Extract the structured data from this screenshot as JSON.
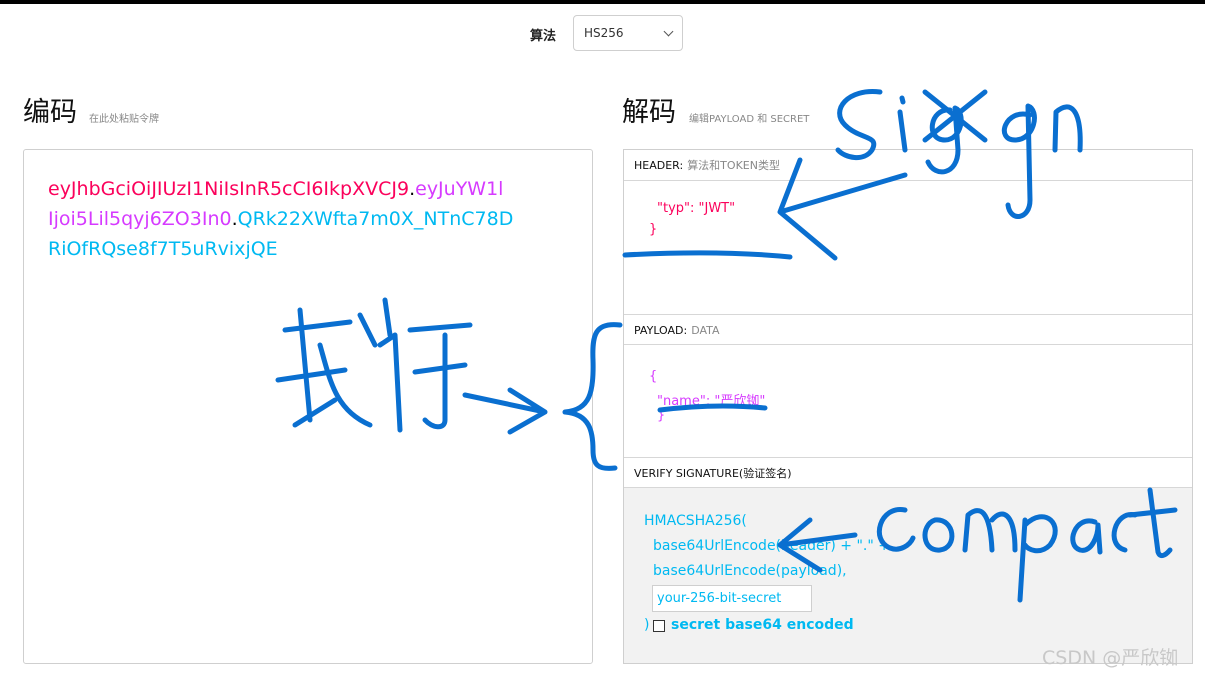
{
  "header": {
    "algorithm_label": "算法",
    "algorithm_value": "HS256"
  },
  "encoded": {
    "title": "编码",
    "subtitle": "在此处粘贴令牌",
    "lines": [
      [
        {
          "t": "eyJhbGciOiJIUzI1NiIsInR5cCI6IkpXVCJ9",
          "c": "red"
        },
        {
          "t": ".",
          "c": "dot"
        },
        {
          "t": "eyJuYW1l",
          "c": "purple"
        }
      ],
      [
        {
          "t": "Ijoi5Lil5qyj6ZO3In0",
          "c": "purple"
        },
        {
          "t": ".",
          "c": "dot"
        },
        {
          "t": "QRk22XWfta7m0X_NTnC78D",
          "c": "cyan"
        }
      ],
      [
        {
          "t": "RiOfRQse8f7T5uRvixjQE",
          "c": "cyan"
        }
      ]
    ]
  },
  "decoded": {
    "title": "解码",
    "subtitle": "编辑PAYLOAD 和 SECRET",
    "header_panel": {
      "label": "HEADER:",
      "sub": "算法和TOKEN类型",
      "line1": "\"typ\": \"JWT\"",
      "line2": "}"
    },
    "payload_panel": {
      "label": "PAYLOAD:",
      "sub": "DATA",
      "line1": "{",
      "line2": "\"name\": \"严欣铷\"",
      "line3": "}"
    },
    "verify_panel": {
      "label": "VERIFY SIGNATURE(验证签名)",
      "line1": "HMACSHA256(",
      "line2": "base64UrlEncode(header) + \".\" +",
      "line3": "base64UrlEncode(payload),",
      "secret_value": "your-256-bit-secret",
      "close": ")",
      "checkbox_label": "secret base64 encoded"
    }
  },
  "watermark": "CSDN @严欣铷",
  "colors": {
    "header": "#fb015b",
    "payload": "#d63aff",
    "signature": "#00b9f1",
    "ink": "#0a6fd0"
  }
}
